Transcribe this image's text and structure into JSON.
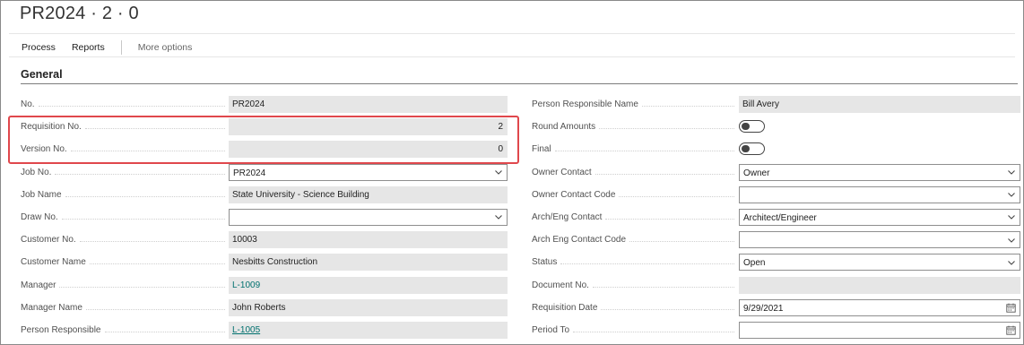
{
  "page": {
    "title": "PR2024 · 2 · 0"
  },
  "actions": {
    "process": "Process",
    "reports": "Reports",
    "more": "More options"
  },
  "section": {
    "title": "General"
  },
  "left": [
    {
      "label": "No.",
      "value": "PR2024",
      "type": "readonly"
    },
    {
      "label": "Requisition No.",
      "value": "2",
      "type": "readonly-num"
    },
    {
      "label": "Version No.",
      "value": "0",
      "type": "readonly-num"
    },
    {
      "label": "Job No.",
      "value": "PR2024",
      "type": "dropdown"
    },
    {
      "label": "Job Name",
      "value": "State University - Science Building",
      "type": "readonly"
    },
    {
      "label": "Draw No.",
      "value": "",
      "type": "dropdown"
    },
    {
      "label": "Customer No.",
      "value": "10003",
      "type": "readonly"
    },
    {
      "label": "Customer Name",
      "value": "Nesbitts Construction",
      "type": "readonly"
    },
    {
      "label": "Manager",
      "value": "L-1009",
      "type": "link"
    },
    {
      "label": "Manager Name",
      "value": "John Roberts",
      "type": "readonly"
    },
    {
      "label": "Person Responsible",
      "value": "L-1005",
      "type": "link-underline"
    }
  ],
  "right": [
    {
      "label": "Person Responsible Name",
      "value": "Bill Avery",
      "type": "readonly"
    },
    {
      "label": "Round Amounts",
      "value": "off",
      "type": "toggle"
    },
    {
      "label": "Final",
      "value": "off",
      "type": "toggle"
    },
    {
      "label": "Owner Contact",
      "value": "Owner",
      "type": "dropdown"
    },
    {
      "label": "Owner Contact Code",
      "value": "",
      "type": "dropdown"
    },
    {
      "label": "Arch/Eng Contact",
      "value": "Architect/Engineer",
      "type": "dropdown"
    },
    {
      "label": "Arch Eng Contact Code",
      "value": "",
      "type": "dropdown"
    },
    {
      "label": "Status",
      "value": "Open",
      "type": "dropdown"
    },
    {
      "label": "Document No.",
      "value": "",
      "type": "readonly"
    },
    {
      "label": "Requisition Date",
      "value": "9/29/2021",
      "type": "date"
    },
    {
      "label": "Period To",
      "value": "",
      "type": "date"
    }
  ],
  "icons": {
    "dropdown": "chevron-down-icon",
    "date": "calendar-icon"
  },
  "colors": {
    "link": "#00706e",
    "highlight": "#e0474c",
    "readonly_bg": "#e6e6e6"
  }
}
